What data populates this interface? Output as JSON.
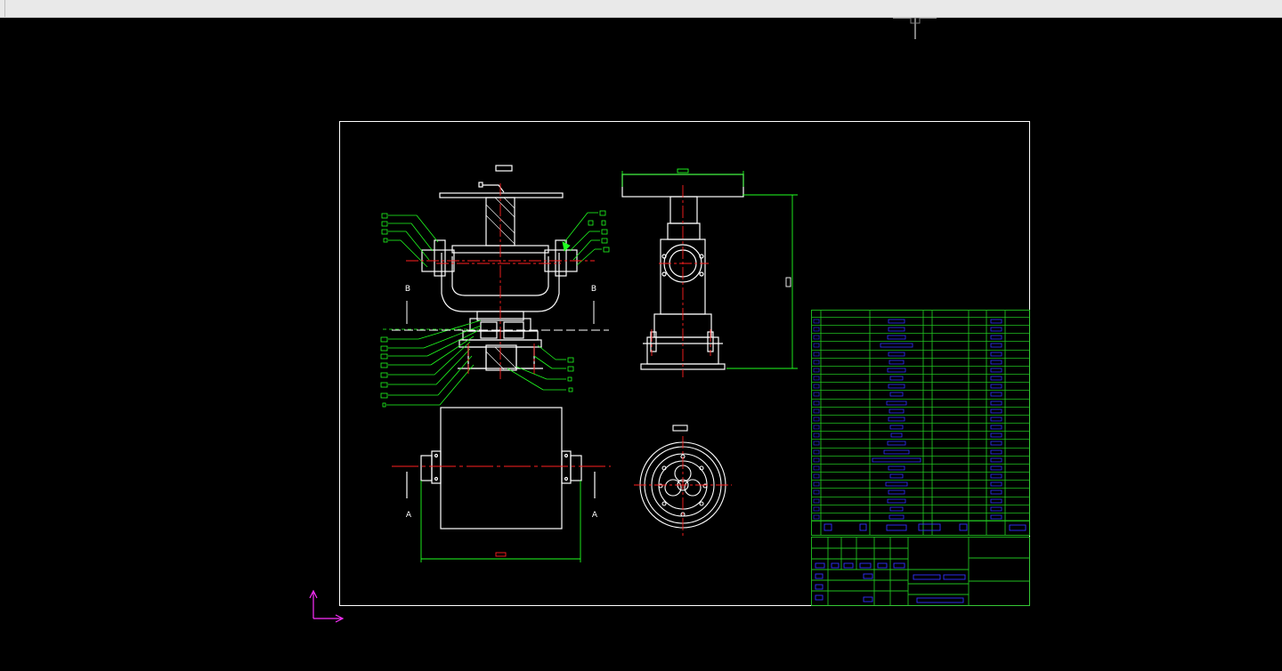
{
  "viewport": {
    "background": "#000000",
    "toolbar_color": "#e9e9e9"
  },
  "drawing": {
    "section_labels": {
      "left_b": "B",
      "right_b": "B",
      "left_a": "A",
      "right_a": "A"
    },
    "colors": {
      "border": "#ffffff",
      "outline": "#ffffff",
      "centerline": "#ff2020",
      "dimension": "#20ff20",
      "table_line": "#20c020",
      "table_text": "#3030ff",
      "ucs": "#ff30ff"
    },
    "icons": [
      "crosshair-cursor-icon",
      "ucs-axis-icon"
    ]
  }
}
